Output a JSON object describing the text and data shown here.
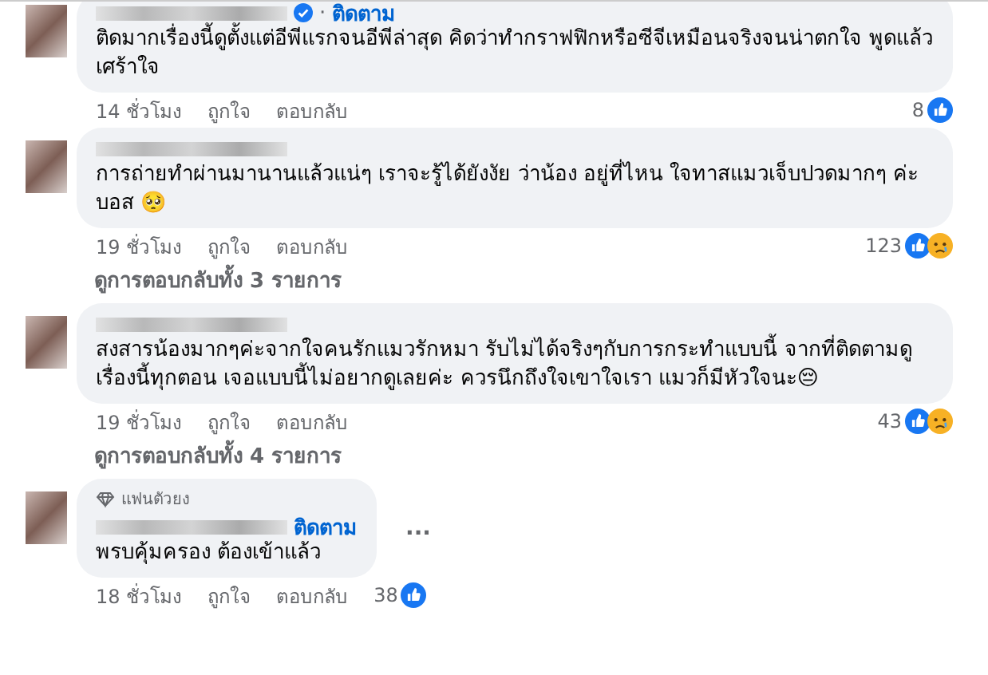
{
  "comments": [
    {
      "verified": true,
      "separator": "·",
      "follow": "ติดตาม",
      "text": "ติดมากเรื่องนี้ดูตั้งแต่อีพีแรกจนอีพีล่าสุด คิดว่าทำกราฟฟิกหรือซีจีเหมือนจริงจนน่าตกใจ พูดแล้วเศร้าใจ",
      "time": "14 ชั่วโมง",
      "like": "ถูกใจ",
      "reply": "ตอบกลับ",
      "count": "8",
      "reactions": [
        {
          "kind": "like"
        }
      ]
    },
    {
      "verified": false,
      "text": "การถ่ายทำผ่านมานานแล้วแน่ๆ เราจะรู้ได้ยังงัย ว่าน้อง อยู่ที่ไหน ใจทาสแมวเจ็บปวดมากๆ ค่ะ บอส 🥺",
      "time": "19 ชั่วโมง",
      "like": "ถูกใจ",
      "reply": "ตอบกลับ",
      "count": "123",
      "reactions": [
        {
          "kind": "like"
        },
        {
          "kind": "sad"
        }
      ],
      "view_replies": "ดูการตอบกลับทั้ง 3 รายการ"
    },
    {
      "verified": false,
      "text": "สงสารน้องมากๆค่ะจากใจคนรักแมวรักหมา รับไม่ได้จริงๆกับการกระทำแบบนี้ จากที่ติดตามดูเรื่องนี้ทุกตอน เจอแบบนี้ไม่อยากดูเลยค่ะ ควรนึกถึงใจเขาใจเรา แมวก็มีหัวใจนะ😔",
      "time": "19 ชั่วโมง",
      "like": "ถูกใจ",
      "reply": "ตอบกลับ",
      "count": "43",
      "reactions": [
        {
          "kind": "like"
        },
        {
          "kind": "sad"
        }
      ],
      "view_replies": "ดูการตอบกลับทั้ง 4 รายการ"
    },
    {
      "badge": "แฟนตัวยง",
      "verified": false,
      "follow": "ติดตาม",
      "text": "พรบคุ้มครอง ต้องเข้าแล้ว",
      "time": "18 ชั่วโมง",
      "like": "ถูกใจ",
      "reply": "ตอบกลับ",
      "count": "38",
      "reactions": [
        {
          "kind": "like"
        }
      ],
      "more": "..."
    }
  ]
}
